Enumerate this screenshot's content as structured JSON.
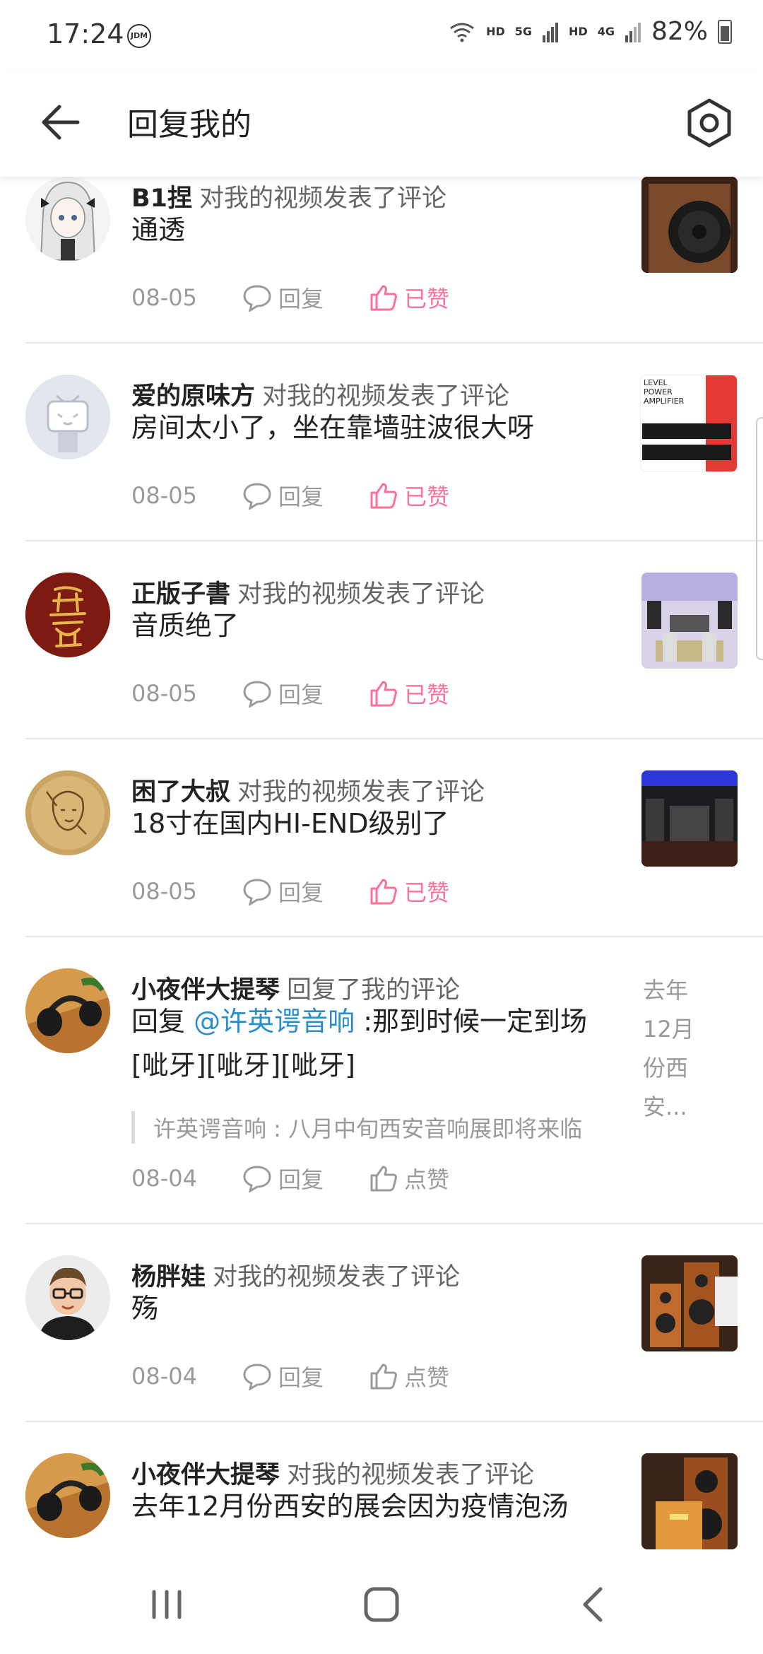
{
  "status_bar": {
    "time": "17:24",
    "badge": "JDM",
    "net1": "HD",
    "net2": "5G",
    "net3": "HD",
    "net4": "4G",
    "battery": "82%"
  },
  "header": {
    "title": "回复我的"
  },
  "ui": {
    "reply_label": "回复",
    "liked_label": "已赞",
    "like_label": "点赞"
  },
  "items": [
    {
      "nick": "B1捏",
      "action": "对我的视频发表了评论",
      "content": "通透",
      "date": "08-05",
      "liked": true
    },
    {
      "nick": "爱的原味方",
      "action": "对我的视频发表了评论",
      "content": "房间太小了，坐在靠墙驻波很大呀",
      "date": "08-05",
      "liked": true,
      "thumb_text": [
        "LEVEL",
        "POWER",
        "AMPLIFIER"
      ]
    },
    {
      "nick": "正版子書",
      "action": "对我的视频发表了评论",
      "content": "音质绝了",
      "date": "08-05",
      "liked": true
    },
    {
      "nick": "困了大叔",
      "action": "对我的视频发表了评论",
      "content": "18寸在国内HI-END级别了",
      "date": "08-05",
      "liked": true
    },
    {
      "nick": "小夜伴大提琴",
      "action": "回复了我的评论",
      "content_prefix": "回复 ",
      "mention": "@许英谔音响",
      "content_suffix": " :那到时候一定到场",
      "content_line2": "[呲牙][呲牙][呲牙]",
      "quote": "许英谔音响 : 八月中旬西安音响展即将来临",
      "date": "08-04",
      "liked": false,
      "side_text": [
        "去年",
        "12月",
        "份西安..."
      ]
    },
    {
      "nick": "杨胖娃",
      "action": "对我的视频发表了评论",
      "content": "殇",
      "date": "08-04",
      "liked": false
    },
    {
      "nick": "小夜伴大提琴",
      "action": "对我的视频发表了评论",
      "content": "去年12月份西安的展会因为疫情泡汤"
    }
  ],
  "colors": {
    "accent": "#fb7299",
    "mention": "#2a8fc9",
    "muted": "#9a9a9a"
  }
}
